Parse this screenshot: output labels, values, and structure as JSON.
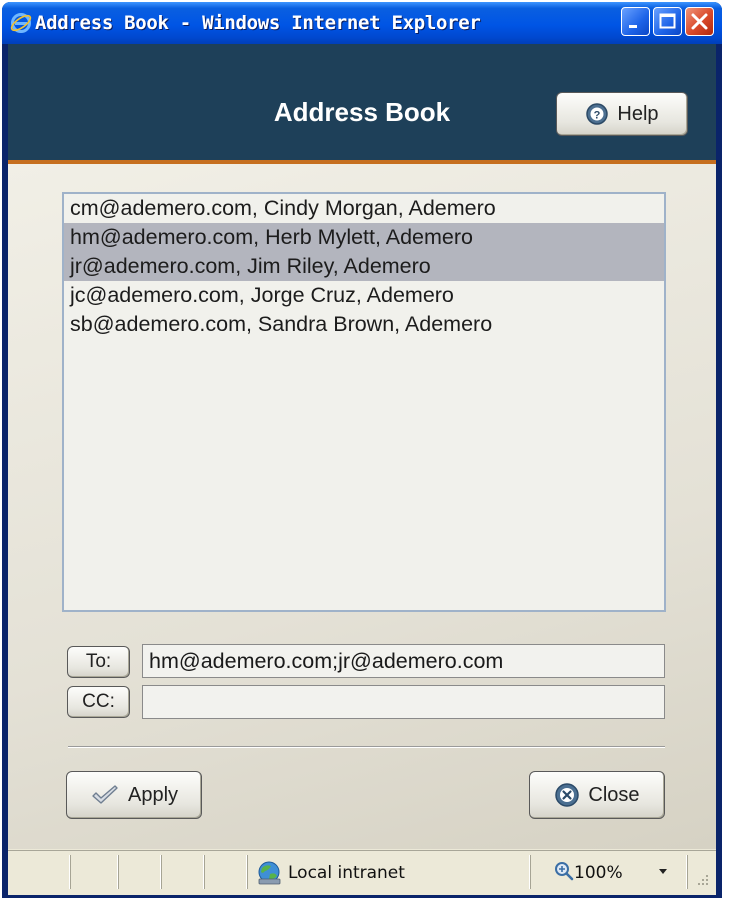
{
  "window": {
    "title": "Address Book - Windows Internet Explorer",
    "controls": [
      "minimize",
      "maximize",
      "close"
    ]
  },
  "header": {
    "title": "Address Book",
    "help_label": "Help"
  },
  "contacts": [
    {
      "text": "cm@ademero.com, Cindy Morgan, Ademero",
      "selected": false
    },
    {
      "text": "hm@ademero.com, Herb Mylett, Ademero",
      "selected": true
    },
    {
      "text": "jr@ademero.com, Jim Riley, Ademero",
      "selected": true
    },
    {
      "text": "jc@ademero.com, Jorge Cruz, Ademero",
      "selected": false
    },
    {
      "text": "sb@ademero.com, Sandra Brown, Ademero",
      "selected": false
    }
  ],
  "recipients": {
    "to_label": "To:",
    "to_value": "hm@ademero.com;jr@ademero.com",
    "cc_label": "CC:",
    "cc_value": ""
  },
  "actions": {
    "apply_label": "Apply",
    "close_label": "Close"
  },
  "statusbar": {
    "zone": "Local intranet",
    "zoom": "100%"
  },
  "colors": {
    "header_bg": "#1e4059",
    "header_accent": "#c66f1f",
    "selection": "#b3b5be"
  },
  "icons": {
    "title": "ie-logo-icon",
    "help": "help-icon",
    "apply": "checkmark-icon",
    "close": "close-circle-icon",
    "zone": "network-globe-icon",
    "zoom": "zoom-icon"
  }
}
